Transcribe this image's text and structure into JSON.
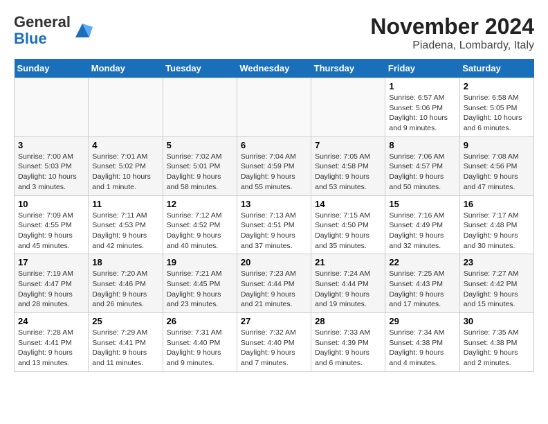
{
  "header": {
    "logo_general": "General",
    "logo_blue": "Blue",
    "month_title": "November 2024",
    "location": "Piadena, Lombardy, Italy"
  },
  "days_of_week": [
    "Sunday",
    "Monday",
    "Tuesday",
    "Wednesday",
    "Thursday",
    "Friday",
    "Saturday"
  ],
  "weeks": [
    [
      {
        "num": "",
        "info": ""
      },
      {
        "num": "",
        "info": ""
      },
      {
        "num": "",
        "info": ""
      },
      {
        "num": "",
        "info": ""
      },
      {
        "num": "",
        "info": ""
      },
      {
        "num": "1",
        "info": "Sunrise: 6:57 AM\nSunset: 5:06 PM\nDaylight: 10 hours and 9 minutes."
      },
      {
        "num": "2",
        "info": "Sunrise: 6:58 AM\nSunset: 5:05 PM\nDaylight: 10 hours and 6 minutes."
      }
    ],
    [
      {
        "num": "3",
        "info": "Sunrise: 7:00 AM\nSunset: 5:03 PM\nDaylight: 10 hours and 3 minutes."
      },
      {
        "num": "4",
        "info": "Sunrise: 7:01 AM\nSunset: 5:02 PM\nDaylight: 10 hours and 1 minute."
      },
      {
        "num": "5",
        "info": "Sunrise: 7:02 AM\nSunset: 5:01 PM\nDaylight: 9 hours and 58 minutes."
      },
      {
        "num": "6",
        "info": "Sunrise: 7:04 AM\nSunset: 4:59 PM\nDaylight: 9 hours and 55 minutes."
      },
      {
        "num": "7",
        "info": "Sunrise: 7:05 AM\nSunset: 4:58 PM\nDaylight: 9 hours and 53 minutes."
      },
      {
        "num": "8",
        "info": "Sunrise: 7:06 AM\nSunset: 4:57 PM\nDaylight: 9 hours and 50 minutes."
      },
      {
        "num": "9",
        "info": "Sunrise: 7:08 AM\nSunset: 4:56 PM\nDaylight: 9 hours and 47 minutes."
      }
    ],
    [
      {
        "num": "10",
        "info": "Sunrise: 7:09 AM\nSunset: 4:55 PM\nDaylight: 9 hours and 45 minutes."
      },
      {
        "num": "11",
        "info": "Sunrise: 7:11 AM\nSunset: 4:53 PM\nDaylight: 9 hours and 42 minutes."
      },
      {
        "num": "12",
        "info": "Sunrise: 7:12 AM\nSunset: 4:52 PM\nDaylight: 9 hours and 40 minutes."
      },
      {
        "num": "13",
        "info": "Sunrise: 7:13 AM\nSunset: 4:51 PM\nDaylight: 9 hours and 37 minutes."
      },
      {
        "num": "14",
        "info": "Sunrise: 7:15 AM\nSunset: 4:50 PM\nDaylight: 9 hours and 35 minutes."
      },
      {
        "num": "15",
        "info": "Sunrise: 7:16 AM\nSunset: 4:49 PM\nDaylight: 9 hours and 32 minutes."
      },
      {
        "num": "16",
        "info": "Sunrise: 7:17 AM\nSunset: 4:48 PM\nDaylight: 9 hours and 30 minutes."
      }
    ],
    [
      {
        "num": "17",
        "info": "Sunrise: 7:19 AM\nSunset: 4:47 PM\nDaylight: 9 hours and 28 minutes."
      },
      {
        "num": "18",
        "info": "Sunrise: 7:20 AM\nSunset: 4:46 PM\nDaylight: 9 hours and 26 minutes."
      },
      {
        "num": "19",
        "info": "Sunrise: 7:21 AM\nSunset: 4:45 PM\nDaylight: 9 hours and 23 minutes."
      },
      {
        "num": "20",
        "info": "Sunrise: 7:23 AM\nSunset: 4:44 PM\nDaylight: 9 hours and 21 minutes."
      },
      {
        "num": "21",
        "info": "Sunrise: 7:24 AM\nSunset: 4:44 PM\nDaylight: 9 hours and 19 minutes."
      },
      {
        "num": "22",
        "info": "Sunrise: 7:25 AM\nSunset: 4:43 PM\nDaylight: 9 hours and 17 minutes."
      },
      {
        "num": "23",
        "info": "Sunrise: 7:27 AM\nSunset: 4:42 PM\nDaylight: 9 hours and 15 minutes."
      }
    ],
    [
      {
        "num": "24",
        "info": "Sunrise: 7:28 AM\nSunset: 4:41 PM\nDaylight: 9 hours and 13 minutes."
      },
      {
        "num": "25",
        "info": "Sunrise: 7:29 AM\nSunset: 4:41 PM\nDaylight: 9 hours and 11 minutes."
      },
      {
        "num": "26",
        "info": "Sunrise: 7:31 AM\nSunset: 4:40 PM\nDaylight: 9 hours and 9 minutes."
      },
      {
        "num": "27",
        "info": "Sunrise: 7:32 AM\nSunset: 4:40 PM\nDaylight: 9 hours and 7 minutes."
      },
      {
        "num": "28",
        "info": "Sunrise: 7:33 AM\nSunset: 4:39 PM\nDaylight: 9 hours and 6 minutes."
      },
      {
        "num": "29",
        "info": "Sunrise: 7:34 AM\nSunset: 4:38 PM\nDaylight: 9 hours and 4 minutes."
      },
      {
        "num": "30",
        "info": "Sunrise: 7:35 AM\nSunset: 4:38 PM\nDaylight: 9 hours and 2 minutes."
      }
    ]
  ]
}
